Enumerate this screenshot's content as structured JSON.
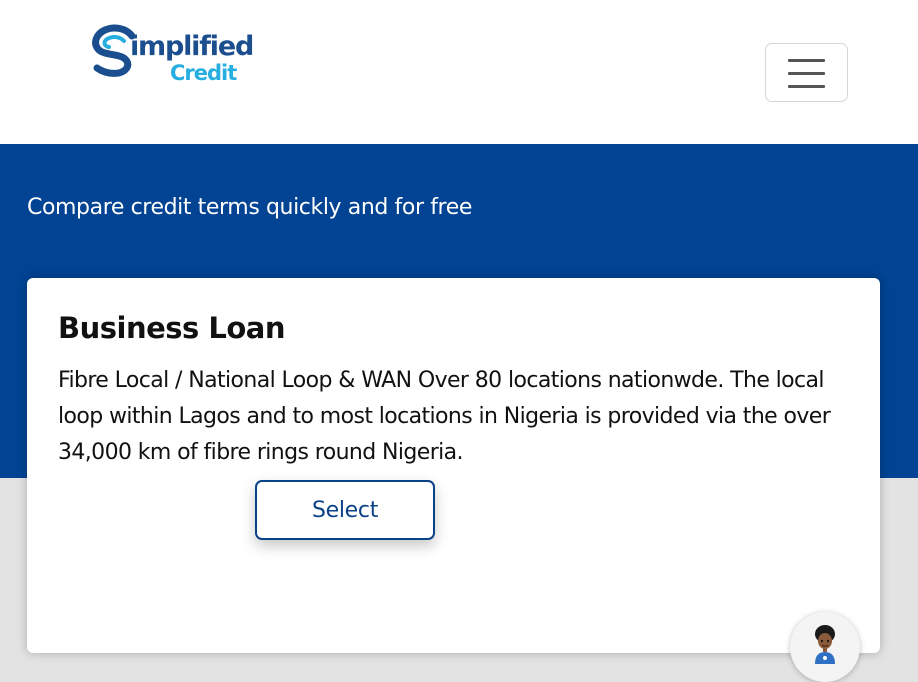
{
  "header": {
    "logo_text_primary": "implified",
    "logo_text_secondary": "Credit",
    "menu_icon": "hamburger-menu-icon"
  },
  "hero": {
    "tagline": "Compare credit terms quickly and for free"
  },
  "card": {
    "title": "Business Loan",
    "description": "Fibre Local / National Loop & WAN Over 80 locations nationwde. The local loop within Lagos and to most locations in Nigeria is provided via the over 34,000 km of fibre rings round Nigeria.",
    "select_label": "Select"
  },
  "chat": {
    "icon": "chat-assistant-avatar-icon"
  },
  "colors": {
    "brand_blue": "#024393",
    "logo_light_blue": "#27aee0",
    "background_gray": "#e3e3e3"
  }
}
